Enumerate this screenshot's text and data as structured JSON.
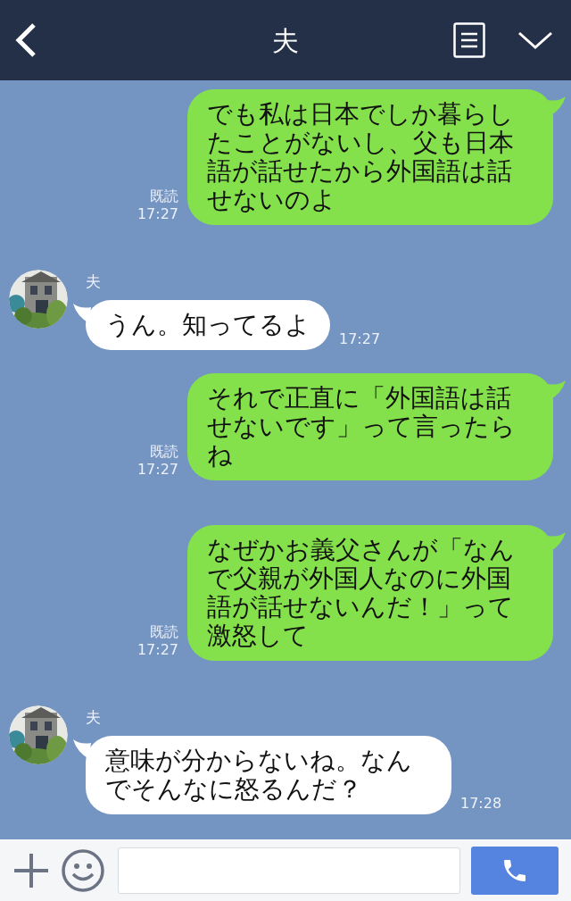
{
  "header": {
    "title": "夫"
  },
  "messages": [
    {
      "kind": "sent",
      "text": "でも私は日本でしか暮らしたことがないし、父も日本語が話せたから外国語は話せないのよ",
      "read": "既読",
      "time": "17:27"
    },
    {
      "kind": "received",
      "sender": "夫",
      "text": "うん。知ってるよ",
      "time": "17:27"
    },
    {
      "kind": "sent",
      "text": "それで正直に「外国語は話せないです」って言ったらね",
      "read": "既読",
      "time": "17:27"
    },
    {
      "kind": "sent",
      "text": "なぜかお義父さんが「なんで父親が外国人なのに外国語が話せないんだ！」って激怒して",
      "read": "既読",
      "time": "17:27"
    },
    {
      "kind": "received",
      "sender": "夫",
      "text": "意味が分からないね。なんでそんなに怒るんだ？",
      "time": "17:28"
    }
  ]
}
